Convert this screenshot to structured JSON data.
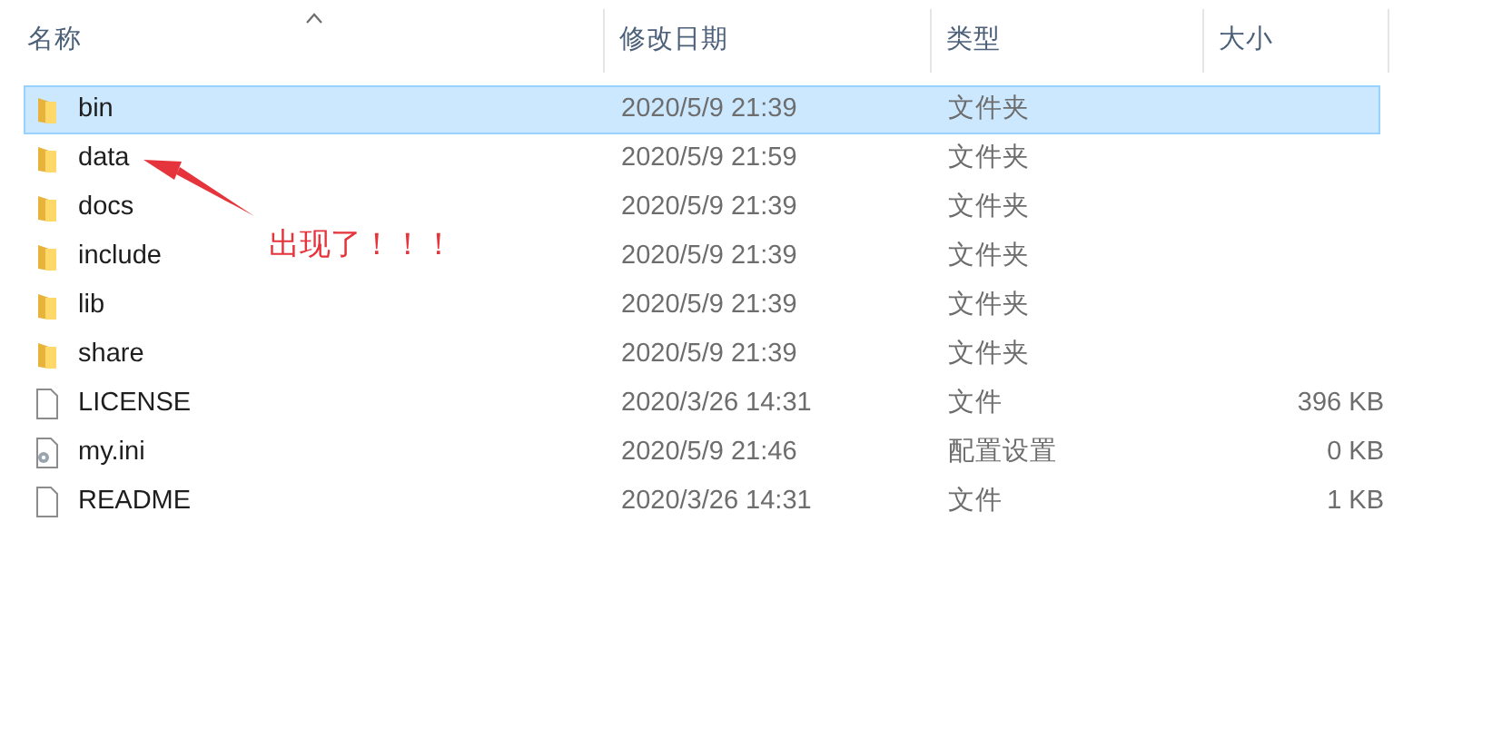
{
  "columns": [
    {
      "label": "名称",
      "sorted": true
    },
    {
      "label": "修改日期",
      "sorted": false
    },
    {
      "label": "类型",
      "sorted": false
    },
    {
      "label": "大小",
      "sorted": false
    }
  ],
  "files": [
    {
      "kind": "folder",
      "name": "bin",
      "modified": "2020/5/9 21:39",
      "type": "文件夹",
      "selected": true
    },
    {
      "kind": "folder",
      "name": "data",
      "modified": "2020/5/9 21:59",
      "type": "文件夹",
      "selected": false
    },
    {
      "kind": "folder",
      "name": "docs",
      "modified": "2020/5/9 21:39",
      "type": "文件夹",
      "selected": false
    },
    {
      "kind": "folder",
      "name": "include",
      "modified": "2020/5/9 21:39",
      "type": "文件夹",
      "selected": false
    },
    {
      "kind": "folder",
      "name": "lib",
      "modified": "2020/5/9 21:39",
      "type": "文件夹",
      "selected": false
    },
    {
      "kind": "folder",
      "name": "share",
      "modified": "2020/5/9 21:39",
      "type": "文件夹",
      "selected": false
    },
    {
      "kind": "file",
      "name": "LICENSE",
      "modified": "2020/3/26 14:31",
      "type": "文件",
      "size": "396 KB",
      "selected": false
    },
    {
      "kind": "config",
      "name": "my.ini",
      "modified": "2020/5/9 21:46",
      "type": "配置设置",
      "size": "0 KB",
      "selected": false
    },
    {
      "kind": "file",
      "name": "README",
      "modified": "2020/3/26 14:31",
      "type": "文件",
      "size": "1 KB",
      "selected": false
    }
  ],
  "annotation": {
    "text": "出现了！！！"
  }
}
